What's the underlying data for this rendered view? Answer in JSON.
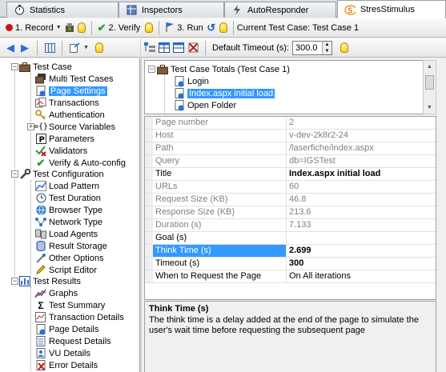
{
  "tabs": [
    {
      "label": "Statistics",
      "icon": "stopwatch-icon"
    },
    {
      "label": "Inspectors",
      "icon": "inspector-icon"
    },
    {
      "label": "AutoResponder",
      "icon": "lightning-icon"
    },
    {
      "label": "StresStimulus",
      "icon": "stresstimulus-logo-icon"
    }
  ],
  "toolbar": {
    "record_label": "1. Record",
    "verify_label": "2. Verify",
    "run_label": "3. Run",
    "current_case_label": "Current Test Case: Test Case 1"
  },
  "right_toolbar": {
    "timeout_label": "Default Timeout (s):",
    "timeout_value": "300.0"
  },
  "tree": {
    "test_case": "Test Case",
    "multi_test_cases": "Multi Test Cases",
    "page_settings": "Page Settings",
    "transactions": "Transactions",
    "authentication": "Authentication",
    "source_variables": "Source Variables",
    "parameters": "Parameters",
    "validators": "Validators",
    "verify_autoconfig": "Verify & Auto-config",
    "test_configuration": "Test Configuration",
    "load_pattern": "Load Pattern",
    "test_duration": "Test Duration",
    "browser_type": "Browser Type",
    "network_type": "Network Type",
    "load_agents": "Load Agents",
    "result_storage": "Result Storage",
    "other_options": "Other Options",
    "script_editor": "Script Editor",
    "test_results": "Test Results",
    "graphs": "Graphs",
    "test_summary": "Test Summary",
    "transaction_details": "Transaction Details",
    "page_details": "Page Details",
    "request_details": "Request Details",
    "vu_details": "VU Details",
    "error_details": "Error Details"
  },
  "summary": {
    "root": "Test Case Totals (Test Case 1)",
    "items": [
      "Login",
      "Index.aspx initial load",
      "Open Folder"
    ]
  },
  "properties": [
    {
      "name": "Page number",
      "value": "2"
    },
    {
      "name": "Host",
      "value": "v-dev-2k8r2-24"
    },
    {
      "name": "Path",
      "value": "/laserfiche/index.aspx"
    },
    {
      "name": "Query",
      "value": "db=IGSTest"
    },
    {
      "name": "Title",
      "value": "Index.aspx initial load"
    },
    {
      "name": "URLs",
      "value": "60"
    },
    {
      "name": "Request Size (KB)",
      "value": "46.8"
    },
    {
      "name": "Response Size (KB)",
      "value": "213.6"
    },
    {
      "name": "Duration (s)",
      "value": "7.133"
    },
    {
      "name": "Goal (s)",
      "value": ""
    },
    {
      "name": "Think Time (s)",
      "value": "2.699"
    },
    {
      "name": "Timeout (s)",
      "value": "300"
    },
    {
      "name": "When to Request the Page",
      "value": "On All iterations"
    }
  ],
  "description": {
    "title": "Think Time (s)",
    "text": "The think time is a delay added at the end of the page to simulate the user's wait time before requesting the subsequent page"
  }
}
